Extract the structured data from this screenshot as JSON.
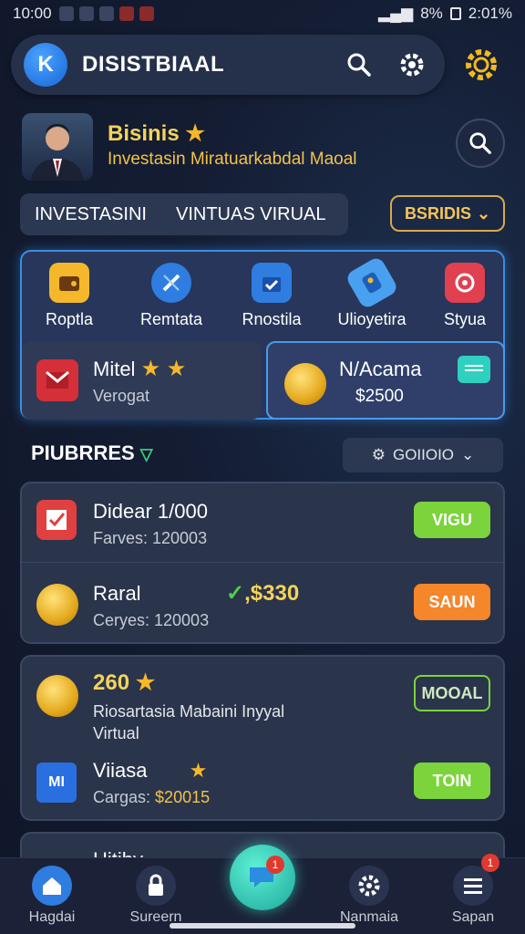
{
  "status": {
    "time": "10:00",
    "battery": "8%",
    "right_time": "2:01%"
  },
  "app": {
    "logo_letter": "K",
    "title": "DISISTBIAAL"
  },
  "profile": {
    "name": "Bisinis",
    "subtitle": "Investasin Miratuarkabdal Maoal"
  },
  "tabs": {
    "tab1": "INVESTASINI",
    "tab2": "VINTUAS VIRUAL",
    "filter": "BSRIDIS"
  },
  "categories": [
    {
      "label": "Roptla",
      "icon": "wallet-icon",
      "color": "#f5b82a"
    },
    {
      "label": "Remtata",
      "icon": "compass-icon",
      "color": "#2f7de0"
    },
    {
      "label": "Rnostila",
      "icon": "briefcase-icon",
      "color": "#2f7de0"
    },
    {
      "label": "Ulioyetira",
      "icon": "rocket-icon",
      "color": "#4aa0f0"
    },
    {
      "label": "Styua",
      "icon": "target-icon",
      "color": "#e04050"
    }
  ],
  "feature": {
    "left": {
      "title": "Mitel",
      "sub": "Verogat"
    },
    "right": {
      "title": "N/Acama",
      "value": "$2500"
    }
  },
  "section": {
    "title": "PIUBRRES",
    "dropdown": "GOIIOIO"
  },
  "cards": [
    {
      "title": "Didear 1/000",
      "sub": "Farves: 120003",
      "btn": "VIGU",
      "btn_color": "#7bd43b"
    },
    {
      "title": "Raral",
      "sub": "Ceryes: 120003",
      "amount": "$330",
      "btn": "SAUN",
      "btn_color": "#f5862a"
    }
  ],
  "card2": {
    "title": "260",
    "desc1": "Riosartasia Mabaini Inyyal",
    "desc2": "Virtual",
    "btn1": "MOOAL",
    "item_title": "Viiasa",
    "item_sub": "Cargas:",
    "item_value": "$20015",
    "btn2": "TOIN"
  },
  "card3": {
    "title": "Hitihy"
  },
  "nav": [
    {
      "label": "Hagdai",
      "icon": "home-icon"
    },
    {
      "label": "Sureern",
      "icon": "lock-icon"
    },
    {
      "label": "Nanmaia",
      "icon": "gear-icon"
    },
    {
      "label": "Sapan",
      "icon": "list-icon"
    }
  ],
  "badges": {
    "fab": "1",
    "sapan": "1"
  }
}
